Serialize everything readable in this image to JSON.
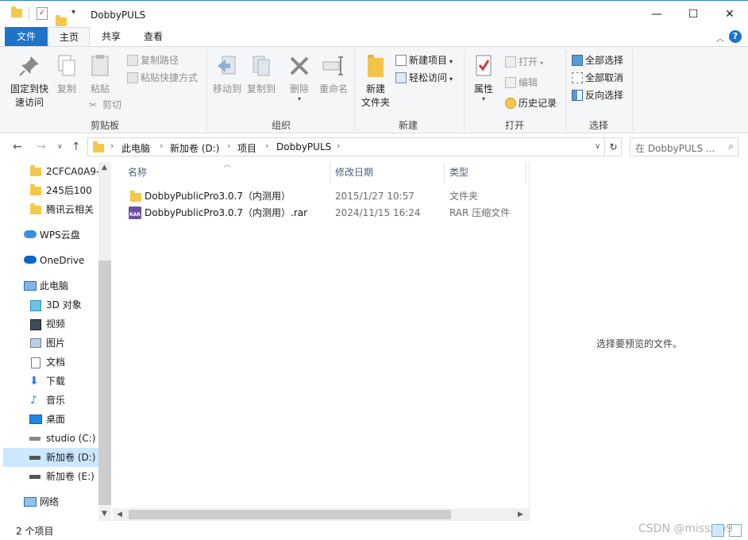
{
  "window": {
    "title": "DobbyPULS",
    "minimize": "—",
    "maximize": "☐",
    "close": "✕"
  },
  "tabs": {
    "file": "文件",
    "home": "主页",
    "share": "共享",
    "view": "查看"
  },
  "ribbon": {
    "clipboard": {
      "label": "剪贴板",
      "pin": "固定到快\n速访问",
      "pin_l1": "固定到快",
      "pin_l2": "速访问",
      "copy": "复制",
      "paste": "粘贴",
      "copy_path": "复制路径",
      "paste_shortcut": "粘贴快捷方式",
      "cut": "剪切"
    },
    "organize": {
      "label": "组织",
      "move_to": "移动到",
      "copy_to": "复制到",
      "delete": "删除",
      "rename": "重命名"
    },
    "new": {
      "label": "新建",
      "new_folder_l1": "新建",
      "new_folder_l2": "文件夹",
      "new_item": "新建项目",
      "easy_access": "轻松访问"
    },
    "open": {
      "label": "打开",
      "properties": "属性",
      "open": "打开",
      "edit": "编辑",
      "history": "历史记录"
    },
    "select": {
      "label": "选择",
      "select_all": "全部选择",
      "select_none": "全部取消",
      "invert": "反向选择"
    }
  },
  "address": {
    "crumbs": [
      "此电脑",
      "新加卷 (D:)",
      "项目",
      "DobbyPULS"
    ],
    "search_placeholder": "在 DobbyPULS ..."
  },
  "sidebar": {
    "items": [
      {
        "label": "2CFCA0A9-",
        "icon": "folder-icon"
      },
      {
        "label": "245后100",
        "icon": "folder-icon"
      },
      {
        "label": "腾讯云相关",
        "icon": "folder-icon"
      },
      {
        "label": "WPS云盘",
        "icon": "cloud-icon"
      },
      {
        "label": "OneDrive",
        "icon": "onedrive-icon"
      },
      {
        "label": "此电脑",
        "icon": "computer-icon"
      },
      {
        "label": "3D 对象",
        "icon": "cube-icon"
      },
      {
        "label": "视频",
        "icon": "video-icon"
      },
      {
        "label": "图片",
        "icon": "picture-icon"
      },
      {
        "label": "文档",
        "icon": "document-icon"
      },
      {
        "label": "下载",
        "icon": "download-icon"
      },
      {
        "label": "音乐",
        "icon": "music-icon"
      },
      {
        "label": "桌面",
        "icon": "desktop-icon"
      },
      {
        "label": "studio (C:)",
        "icon": "drive-icon"
      },
      {
        "label": "新加卷 (D:)",
        "icon": "drive-icon"
      },
      {
        "label": "新加卷 (E:)",
        "icon": "drive-icon"
      },
      {
        "label": "网络",
        "icon": "network-icon"
      }
    ]
  },
  "filelist": {
    "columns": [
      "名称",
      "修改日期",
      "类型"
    ],
    "rows": [
      {
        "name": "DobbyPublicPro3.0.7（内测用）",
        "date": "2015/1/27 10:57",
        "type": "文件夹",
        "icon": "folder-icon"
      },
      {
        "name": "DobbyPublicPro3.0.7（内测用）.rar",
        "date": "2024/11/15 16:24",
        "type": "RAR 压缩文件",
        "icon": "rar-icon"
      }
    ]
  },
  "preview": {
    "message": "选择要预览的文件。"
  },
  "status": {
    "count": "2 个项目",
    "watermark": "CSDN @misszlo9"
  },
  "colors": {
    "accent": "#1e73c9",
    "selected": "#cce8ff",
    "folder": "#f5c84c"
  }
}
